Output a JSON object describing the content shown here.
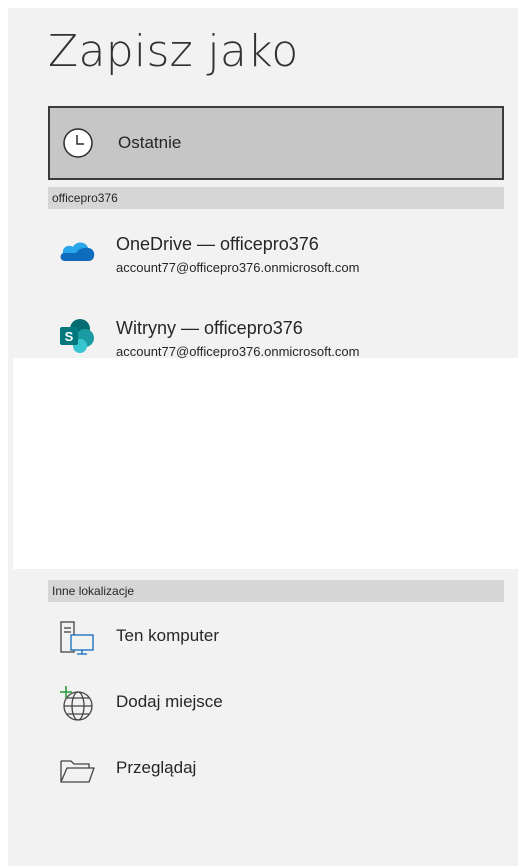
{
  "header": {
    "title": "Zapisz jako"
  },
  "recent": {
    "label": "Ostatnie",
    "icon": "clock-icon"
  },
  "account_section": {
    "header": "officepro376",
    "places": [
      {
        "title": "OneDrive — officepro376",
        "subtitle": "account77@officepro376.onmicrosoft.com",
        "icon": "onedrive-icon"
      },
      {
        "title": "Witryny — officepro376",
        "subtitle": "account77@officepro376.onmicrosoft.com",
        "icon": "sharepoint-icon"
      }
    ]
  },
  "other_section": {
    "header": "Inne lokalizacje",
    "items": [
      {
        "label": "Ten komputer",
        "icon": "computer-icon"
      },
      {
        "label": "Dodaj miejsce",
        "icon": "add-place-globe-icon"
      },
      {
        "label": "Przeglądaj",
        "icon": "folder-icon"
      }
    ]
  },
  "colors": {
    "panel_bg": "#f2f2f2",
    "selected_bg": "#c6c6c6",
    "section_header_bg": "#d6d6d6",
    "onedrive_blue": "#0f6cbd",
    "sharepoint_teal": "#038387",
    "add_green": "#2e9e3e"
  }
}
